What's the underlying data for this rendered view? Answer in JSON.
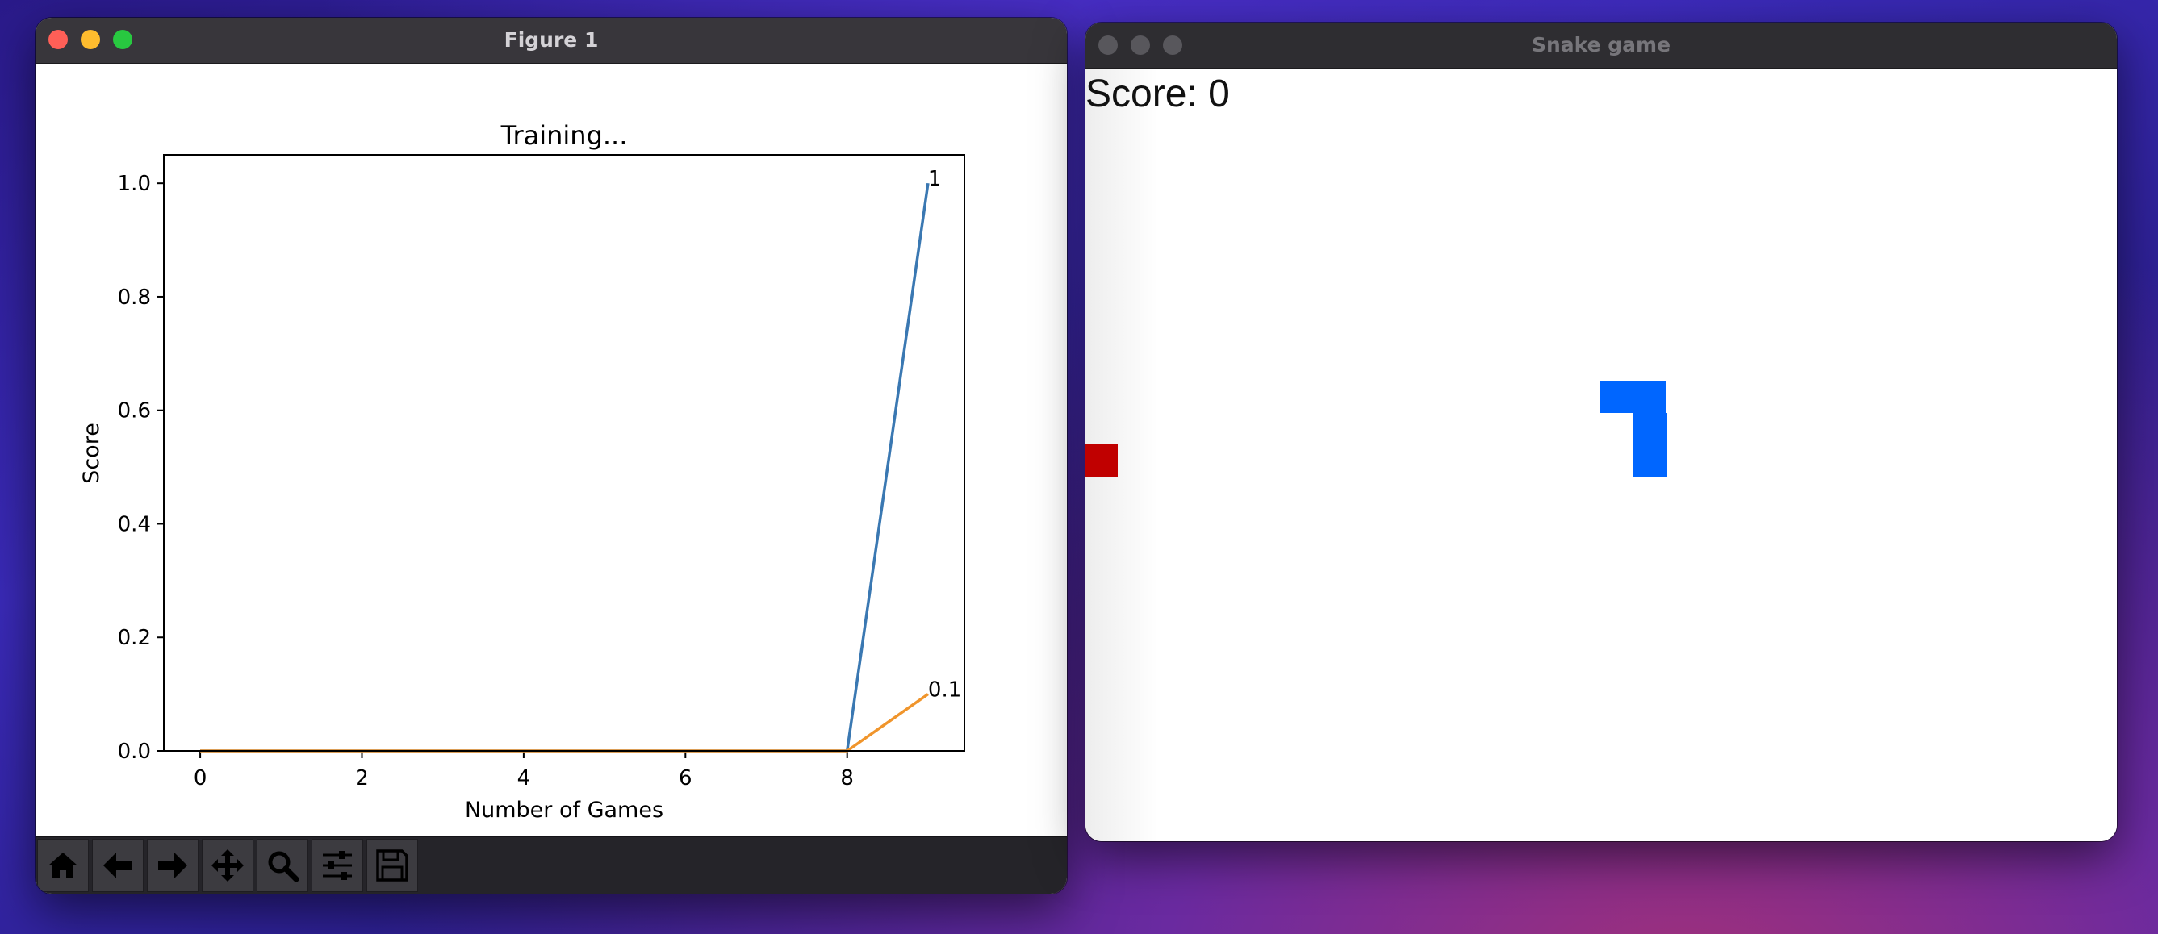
{
  "figure_window": {
    "title": "Figure 1",
    "toolbar": [
      {
        "name": "home-button",
        "icon": "home-icon"
      },
      {
        "name": "back-button",
        "icon": "arrow-left-icon"
      },
      {
        "name": "forward-button",
        "icon": "arrow-right-icon"
      },
      {
        "name": "pan-button",
        "icon": "move-icon"
      },
      {
        "name": "zoom-button",
        "icon": "magnifier-icon"
      },
      {
        "name": "configure-subplots-button",
        "icon": "sliders-icon"
      },
      {
        "name": "save-button",
        "icon": "floppy-disk-icon"
      }
    ]
  },
  "chart_data": {
    "type": "line",
    "title": "Training...",
    "xlabel": "Number of Games",
    "ylabel": "Score",
    "xlim": [
      -0.45,
      9.45
    ],
    "ylim": [
      0,
      1.05
    ],
    "xticks": [
      0,
      2,
      4,
      6,
      8
    ],
    "yticks": [
      "0.0",
      "0.2",
      "0.4",
      "0.6",
      "0.8",
      "1.0"
    ],
    "grid": false,
    "series": [
      {
        "color": "#3a78b2",
        "x": [
          0,
          1,
          2,
          3,
          4,
          5,
          6,
          7,
          8,
          9
        ],
        "y": [
          0,
          0,
          0,
          0,
          0,
          0,
          0,
          0,
          0,
          1
        ],
        "end_label": "1"
      },
      {
        "color": "#f0952c",
        "x": [
          0,
          1,
          2,
          3,
          4,
          5,
          6,
          7,
          8,
          9
        ],
        "y": [
          0,
          0,
          0,
          0,
          0,
          0,
          0,
          0,
          0,
          0.1
        ],
        "end_label": "0.1"
      }
    ]
  },
  "snake_window": {
    "title": "Snake game",
    "score_text": "Score: 0",
    "colors": {
      "snake": "#0066ff",
      "food": "#c00000"
    }
  }
}
